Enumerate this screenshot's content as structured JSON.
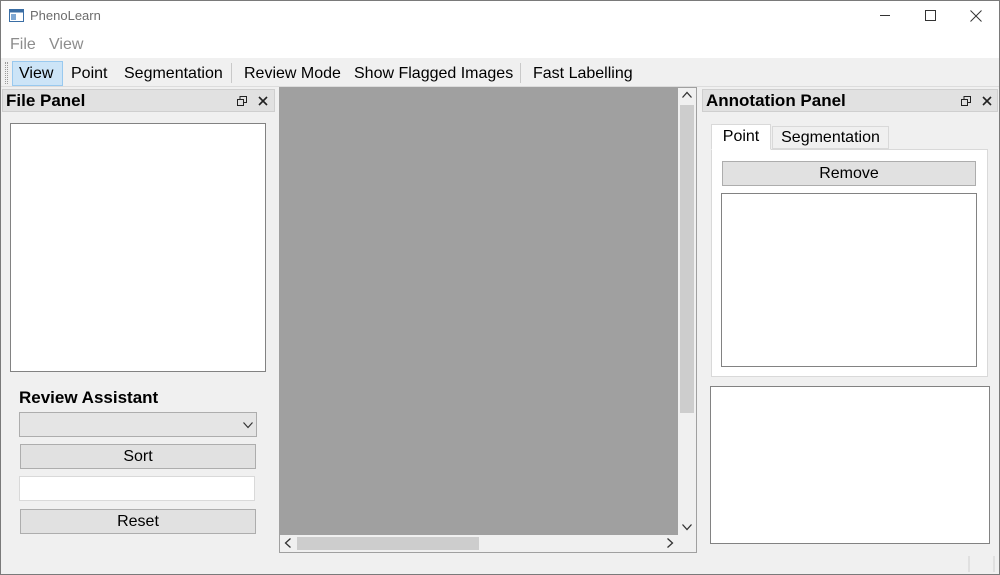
{
  "window": {
    "title": "PhenoLearn"
  },
  "menu": {
    "items": [
      {
        "label": "File"
      },
      {
        "label": "View"
      }
    ]
  },
  "toolbar": {
    "buttons": [
      {
        "label": "View",
        "active": true
      },
      {
        "label": "Point",
        "active": false
      },
      {
        "label": "Segmentation",
        "active": false
      },
      {
        "label": "Review Mode",
        "active": false
      },
      {
        "label": "Show Flagged Images",
        "active": false
      },
      {
        "label": "Fast Labelling",
        "active": false
      }
    ]
  },
  "file_panel": {
    "title": "File Panel",
    "review_assistant": {
      "heading": "Review Assistant",
      "combo_value": "",
      "sort_label": "Sort",
      "input_value": "",
      "reset_label": "Reset"
    }
  },
  "annotation_panel": {
    "title": "Annotation Panel",
    "tabs": [
      {
        "label": "Point",
        "selected": true
      },
      {
        "label": "Segmentation",
        "selected": false
      }
    ],
    "remove_label": "Remove"
  },
  "icons": {
    "app": "app-window-icon",
    "minimize": "minimize-icon",
    "maximize": "maximize-icon",
    "close": "close-icon",
    "float": "float-icon",
    "dock_close": "close-icon",
    "combo_arrow": "chevron-down-icon"
  },
  "colors": {
    "toolbar_active_bg": "#cce4f7",
    "toolbar_active_border": "#99c9ef",
    "canvas_bg": "#a0a0a0",
    "dock_header_bg": "#e1e1e1"
  }
}
